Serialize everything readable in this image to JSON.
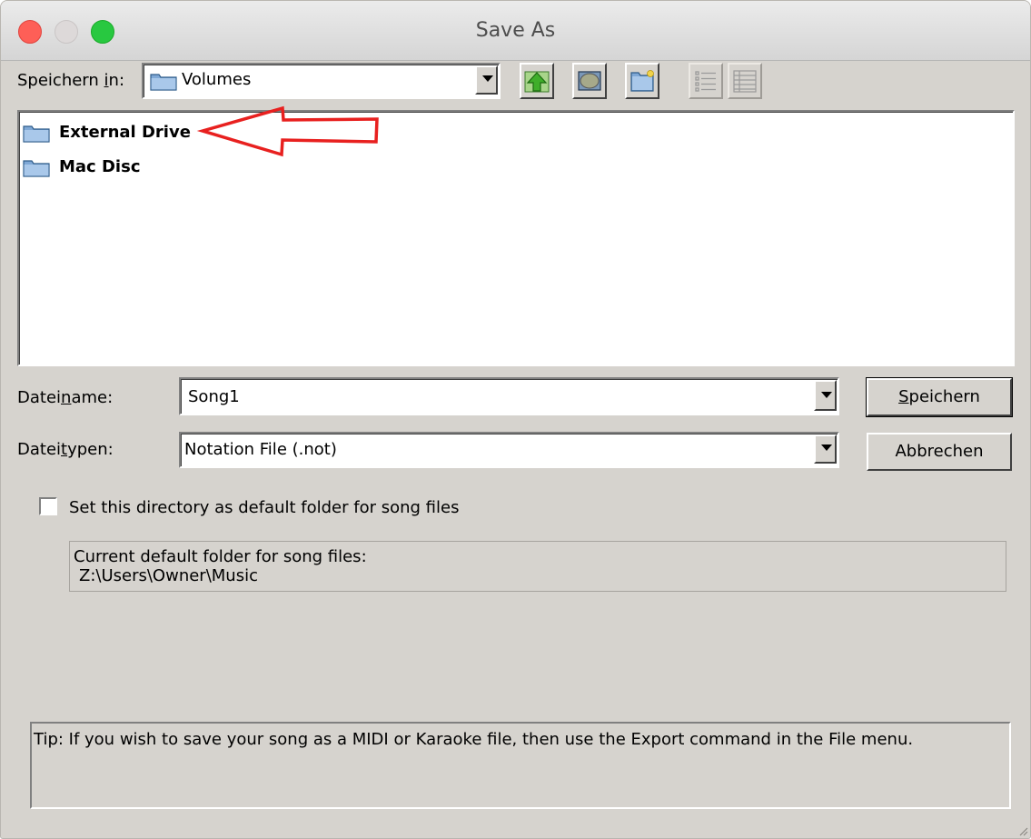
{
  "window": {
    "title": "Save As"
  },
  "location": {
    "label_before": "Speichern ",
    "label_accel": "i",
    "label_after": "n:",
    "value": "Volumes"
  },
  "toolbar": {
    "up_icon": "up-folder-icon",
    "desktop_icon": "desktop-icon",
    "new_folder_icon": "new-folder-icon",
    "list_icon": "list-view-icon",
    "details_icon": "details-view-icon"
  },
  "files": [
    {
      "name": "External Drive",
      "icon": "folder-icon"
    },
    {
      "name": "Mac Disc",
      "icon": "folder-icon"
    }
  ],
  "filename": {
    "label_before": "Datei",
    "label_accel": "n",
    "label_after": "ame:",
    "value": "Song1"
  },
  "filetype": {
    "label_before": "Datei",
    "label_accel": "t",
    "label_after": "ypen:",
    "value": "Notation File (.not)"
  },
  "buttons": {
    "save_accel": "S",
    "save_rest": "peichern",
    "cancel": "Abbrechen"
  },
  "default_folder": {
    "checkbox_label": "Set this directory as default folder for song files",
    "checked": false,
    "current_label": "Current default folder for song files:",
    "current_path": "Z:\\Users\\Owner\\Music"
  },
  "tip": "Tip: If you wish to save your song as a MIDI or Karaoke file, then use the Export command in the File menu.",
  "colors": {
    "annotation_arrow": "#e8201f",
    "dialog_bg": "#d6d3ce",
    "close": "#fe5f57",
    "maximize": "#28c840"
  }
}
